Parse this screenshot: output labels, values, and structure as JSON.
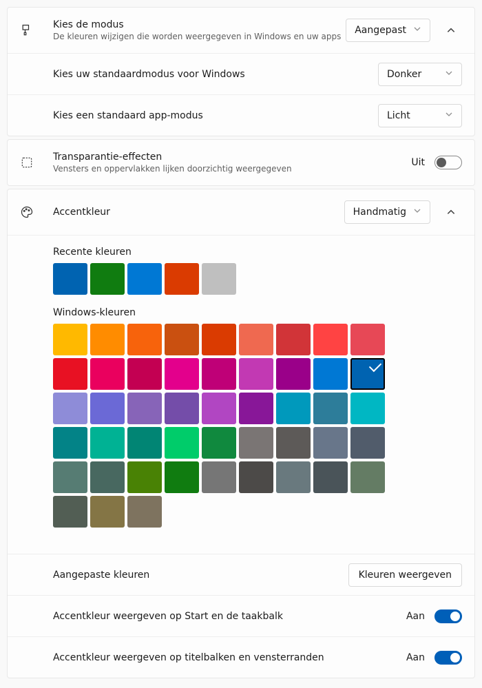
{
  "mode": {
    "title": "Kies de modus",
    "subtitle": "De kleuren wijzigen die worden weergegeven in Windows en uw apps",
    "select_value": "Aangepast",
    "windows_mode_label": "Kies uw standaardmodus voor Windows",
    "windows_mode_value": "Donker",
    "app_mode_label": "Kies een standaard app-modus",
    "app_mode_value": "Licht"
  },
  "transparency": {
    "title": "Transparantie-effecten",
    "subtitle": "Vensters en oppervlakken lijken doorzichtig weergegeven",
    "status": "Uit",
    "on": false
  },
  "accent": {
    "title": "Accentkleur",
    "select_value": "Handmatig",
    "recent_label": "Recente kleuren",
    "recent_colors": [
      "#0063B1",
      "#107C10",
      "#0078D4",
      "#DA3B01",
      "#BFBFBF"
    ],
    "windows_label": "Windows-kleuren",
    "windows_colors": [
      "#FFB900",
      "#FF8C00",
      "#F7630C",
      "#CA5010",
      "#DA3B01",
      "#EF6950",
      "#D13438",
      "#FF4343",
      "#E74856",
      "#E81123",
      "#EA005E",
      "#C30052",
      "#E3008C",
      "#BF0077",
      "#C239B3",
      "#9A0089",
      "#0078D4",
      "#0063B1",
      "#8E8CD8",
      "#6B69D6",
      "#8764B8",
      "#744DA9",
      "#B146C2",
      "#881798",
      "#0099BC",
      "#2D7D9A",
      "#00B7C3",
      "#038387",
      "#00B294",
      "#018574",
      "#00CC6A",
      "#10893E",
      "#7A7574",
      "#5D5A58",
      "#68768A",
      "#515C6B",
      "#567C73",
      "#486860",
      "#498205",
      "#107C10",
      "#767676",
      "#4C4A48",
      "#69797E",
      "#4A5459",
      "#647C64",
      "#525E54",
      "#847545",
      "#7E735F"
    ],
    "selected_index": 17,
    "custom_title": "Aangepaste kleuren",
    "custom_button": "Kleuren weergeven",
    "start_taskbar_title": "Accentkleur weergeven op Start en de taakbalk",
    "start_taskbar_status": "Aan",
    "start_taskbar_on": true,
    "titlebar_title": "Accentkleur weergeven op titelbalken en vensterranden",
    "titlebar_status": "Aan",
    "titlebar_on": true
  }
}
